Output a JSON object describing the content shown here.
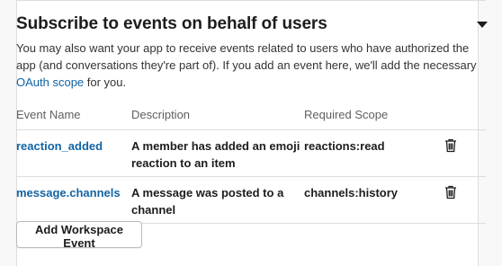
{
  "section": {
    "title": "Subscribe to events on behalf of users",
    "description_parts": {
      "before": "You may also want your app to receive events related to users who have authorized the app (and conversations they're part of). If you add an event here, we'll add the necessary ",
      "link": "OAuth scope",
      "after": " for you."
    },
    "collapse_icon": "caret-down-icon"
  },
  "table": {
    "headers": [
      "Event Name",
      "Description",
      "Required Scope"
    ],
    "rows": [
      {
        "event": "reaction_added",
        "description": "A member has added an emoji reaction to an item",
        "scope": "reactions:read",
        "action_icon": "trash-icon"
      },
      {
        "event": "message.channels",
        "description": "A message was posted to a channel",
        "scope": "channels:history",
        "action_icon": "trash-icon"
      }
    ]
  },
  "buttons": {
    "add_event": "Add Workspace Event"
  },
  "colors": {
    "link": "#1264a3",
    "text": "#1d1c1d",
    "muted": "#616061",
    "border": "#dddddd"
  }
}
